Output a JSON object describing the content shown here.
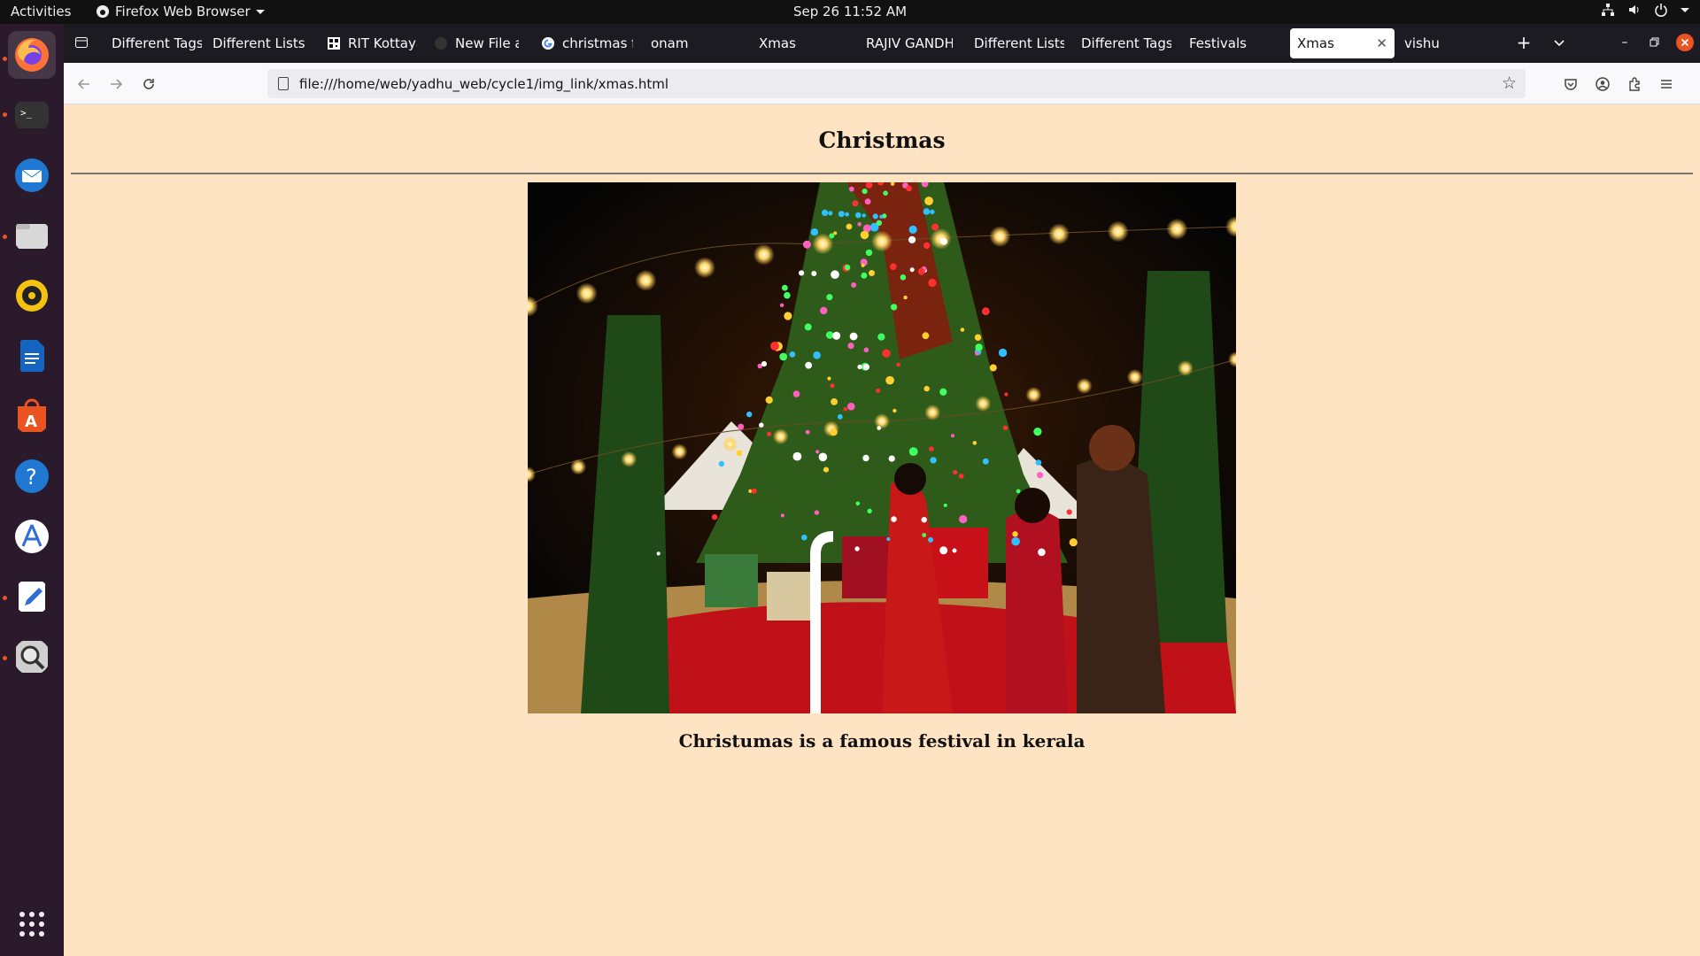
{
  "topbar": {
    "activities": "Activities",
    "app_name": "Firefox Web Browser",
    "clock": "Sep 26  11:52 AM"
  },
  "dock": {
    "items": [
      {
        "name": "firefox",
        "color": "#ff7139"
      },
      {
        "name": "terminal",
        "color": "#333333"
      },
      {
        "name": "thunderbird",
        "color": "#1f78d1"
      },
      {
        "name": "files",
        "color": "#d8d8d8"
      },
      {
        "name": "rhythmbox",
        "color": "#f5c211"
      },
      {
        "name": "libreoffice-writer",
        "color": "#1565c0"
      },
      {
        "name": "app-center",
        "color": "#e95420"
      },
      {
        "name": "help",
        "color": "#1f78d1"
      },
      {
        "name": "software-updater",
        "color": "#2f6ed6"
      },
      {
        "name": "text-editor",
        "color": "#ffffff"
      },
      {
        "name": "screenshot",
        "color": "#cfcfcf"
      }
    ]
  },
  "browser": {
    "tabs": [
      {
        "label": "Different Tags",
        "selected": false
      },
      {
        "label": "Different Lists",
        "selected": false
      },
      {
        "label": "RIT Kottayam",
        "selected": false
      },
      {
        "label": "New File at",
        "selected": false
      },
      {
        "label": "christmas fe",
        "selected": false
      },
      {
        "label": "onam",
        "selected": false
      },
      {
        "label": "Xmas",
        "selected": false
      },
      {
        "label": "RAJIV GANDHI",
        "selected": false
      },
      {
        "label": "Different Lists",
        "selected": false
      },
      {
        "label": "Different Tags",
        "selected": false
      },
      {
        "label": "Festivals",
        "selected": false
      },
      {
        "label": "Xmas",
        "selected": true
      },
      {
        "label": "vishu",
        "selected": false
      }
    ],
    "new_tab_icon": "plus-icon",
    "tab_list_icon": "chevron-down-icon",
    "url": "file:///home/web/yadhu_web/cycle1/img_link/xmas.html"
  },
  "page": {
    "heading": "Christmas",
    "caption": "Christumas is a famous festival in kerala",
    "background": "#ffe4c4"
  }
}
